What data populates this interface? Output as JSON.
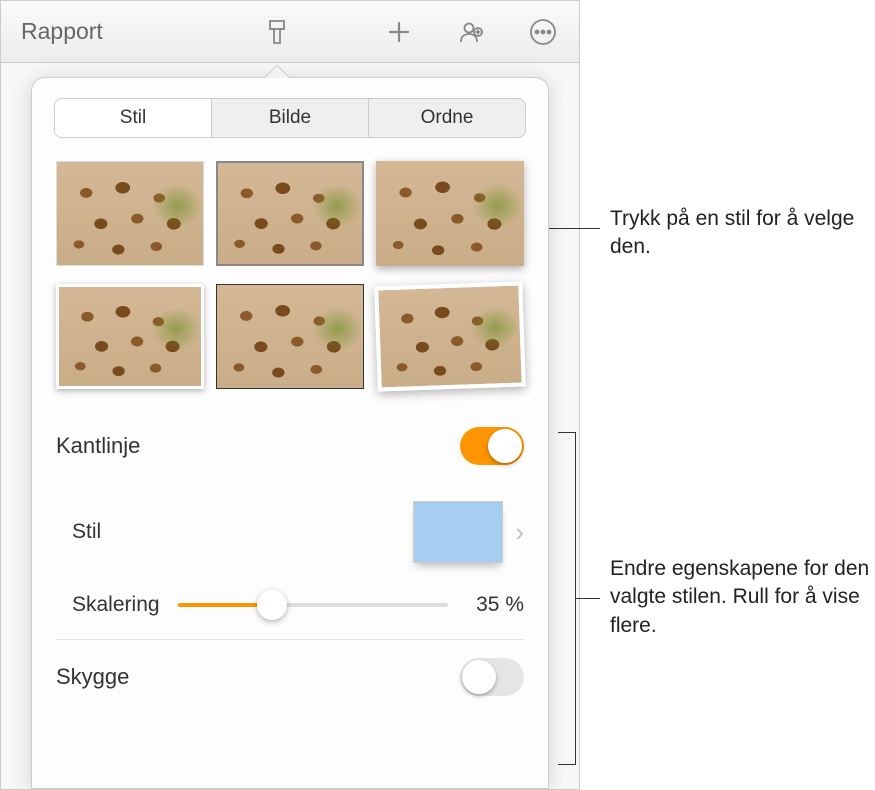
{
  "document": {
    "title": "Rapport"
  },
  "tabs": {
    "items": [
      {
        "label": "Stil",
        "active": true
      },
      {
        "label": "Bilde",
        "active": false
      },
      {
        "label": "Ordne",
        "active": false
      }
    ]
  },
  "border": {
    "label": "Kantlinje",
    "enabled": true
  },
  "style": {
    "label": "Stil",
    "preview_color": "#a5cef1"
  },
  "scaling": {
    "label": "Skalering",
    "value": 35,
    "display": "35 %"
  },
  "shadow": {
    "label": "Skygge",
    "enabled": false
  },
  "callouts": {
    "style_thumb": "Trykk på en stil for å velge den.",
    "properties": "Endre egenskapene for den valgte stilen. Rull for å vise flere."
  }
}
